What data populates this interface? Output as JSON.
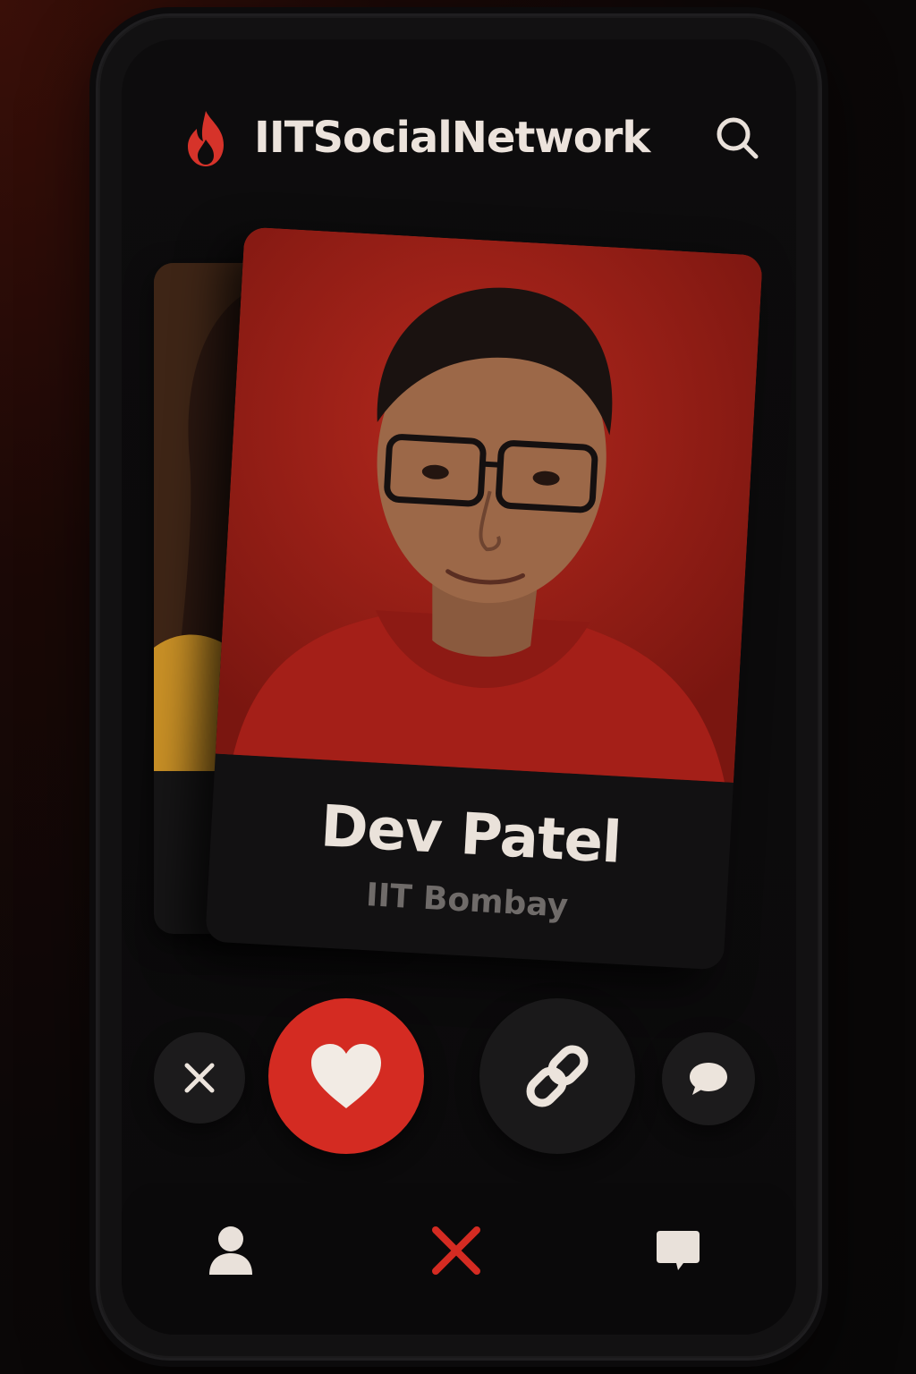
{
  "app": {
    "title": "IITSocialNetwork",
    "brand_color": "#d42b22"
  },
  "header": {
    "logo_icon": "flame-icon",
    "search_icon": "search-icon"
  },
  "cards": {
    "current": {
      "name": "Dev Patel",
      "school": "IIT Bombay"
    }
  },
  "actions": [
    {
      "id": "dismiss",
      "icon": "close-icon"
    },
    {
      "id": "like",
      "icon": "heart-icon"
    },
    {
      "id": "connect",
      "icon": "link-icon"
    },
    {
      "id": "message",
      "icon": "chat-bubble-icon"
    }
  ],
  "bottom_nav": [
    {
      "id": "profile",
      "icon": "person-icon"
    },
    {
      "id": "home",
      "icon": "x-logo-icon",
      "active": true
    },
    {
      "id": "chats",
      "icon": "chat-icon"
    }
  ]
}
